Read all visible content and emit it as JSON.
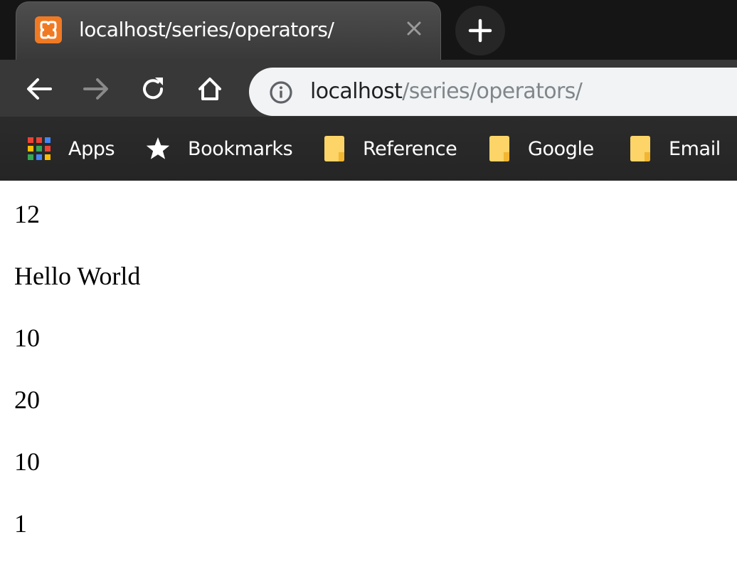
{
  "tab": {
    "title": "localhost/series/operators/",
    "favicon": "xampp-icon",
    "close_icon": "close-icon"
  },
  "new_tab_icon": "plus-icon",
  "toolbar": {
    "back_icon": "arrow-left-icon",
    "forward_icon": "arrow-right-icon",
    "reload_icon": "reload-icon",
    "home_icon": "home-icon"
  },
  "omnibox": {
    "info_icon": "info-icon",
    "host": "localhost",
    "path": "/series/operators/"
  },
  "bookmarks": [
    {
      "label": "Apps",
      "icon": "apps-grid-icon"
    },
    {
      "label": "Bookmarks",
      "icon": "star-icon"
    },
    {
      "label": "Reference",
      "icon": "folder-icon"
    },
    {
      "label": "Google",
      "icon": "folder-icon"
    },
    {
      "label": "Email",
      "icon": "folder-icon"
    }
  ],
  "page": {
    "lines": [
      "12",
      "Hello World",
      "10",
      "20",
      "10",
      "1"
    ]
  },
  "colors": {
    "tab_bg": "#444444",
    "frame_bg": "#151515",
    "toolbar_bg": "#383838",
    "omnibox_bg": "#f1f3f4",
    "url_path": "#80868b",
    "favicon": "#f07a24",
    "folder": "#fcd468"
  }
}
